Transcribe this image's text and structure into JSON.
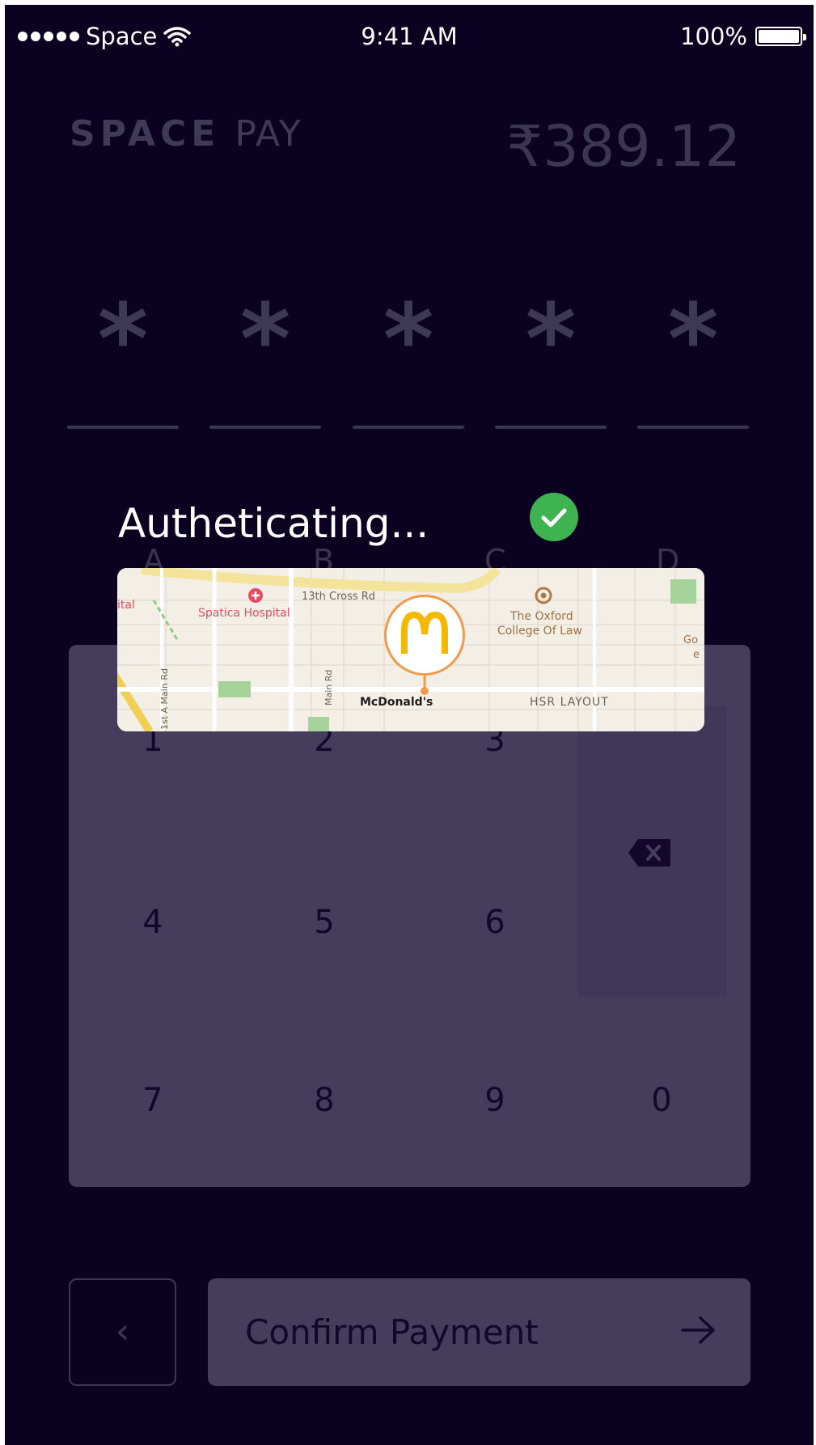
{
  "status_bar": {
    "carrier": "Space",
    "time": "9:41 AM",
    "battery": "100%"
  },
  "header": {
    "brand_bold": "SPACE",
    "brand_light": "PAY",
    "amount": "₹389.12"
  },
  "pin": {
    "digits": [
      "*",
      "*",
      "*",
      "*",
      "*"
    ]
  },
  "auth": {
    "message": "Autheticating..."
  },
  "columns": [
    "A",
    "B",
    "C",
    "D"
  ],
  "keypad": {
    "keys": [
      "1",
      "2",
      "3",
      "4",
      "5",
      "6",
      "7",
      "8",
      "9",
      "0"
    ]
  },
  "map": {
    "place": "McDonald's",
    "labels": {
      "hospital": "Spatica Hospital",
      "hospital_cut": "ital",
      "road_13": "13th Cross Rd",
      "college_line1": "The Oxford",
      "college_line2": "College Of Law",
      "layout": "HSR LAYOUT",
      "main_rd": "Main Rd",
      "a_main": "1st A Main Rd",
      "edge": "Go",
      "edge2": "e"
    }
  },
  "actions": {
    "back": "‹",
    "confirm": "Confirm Payment"
  },
  "colors": {
    "background": "#0b0121",
    "keypad": "#463c5c",
    "success": "#3fb34f",
    "map_pin": "#f09a4a"
  }
}
